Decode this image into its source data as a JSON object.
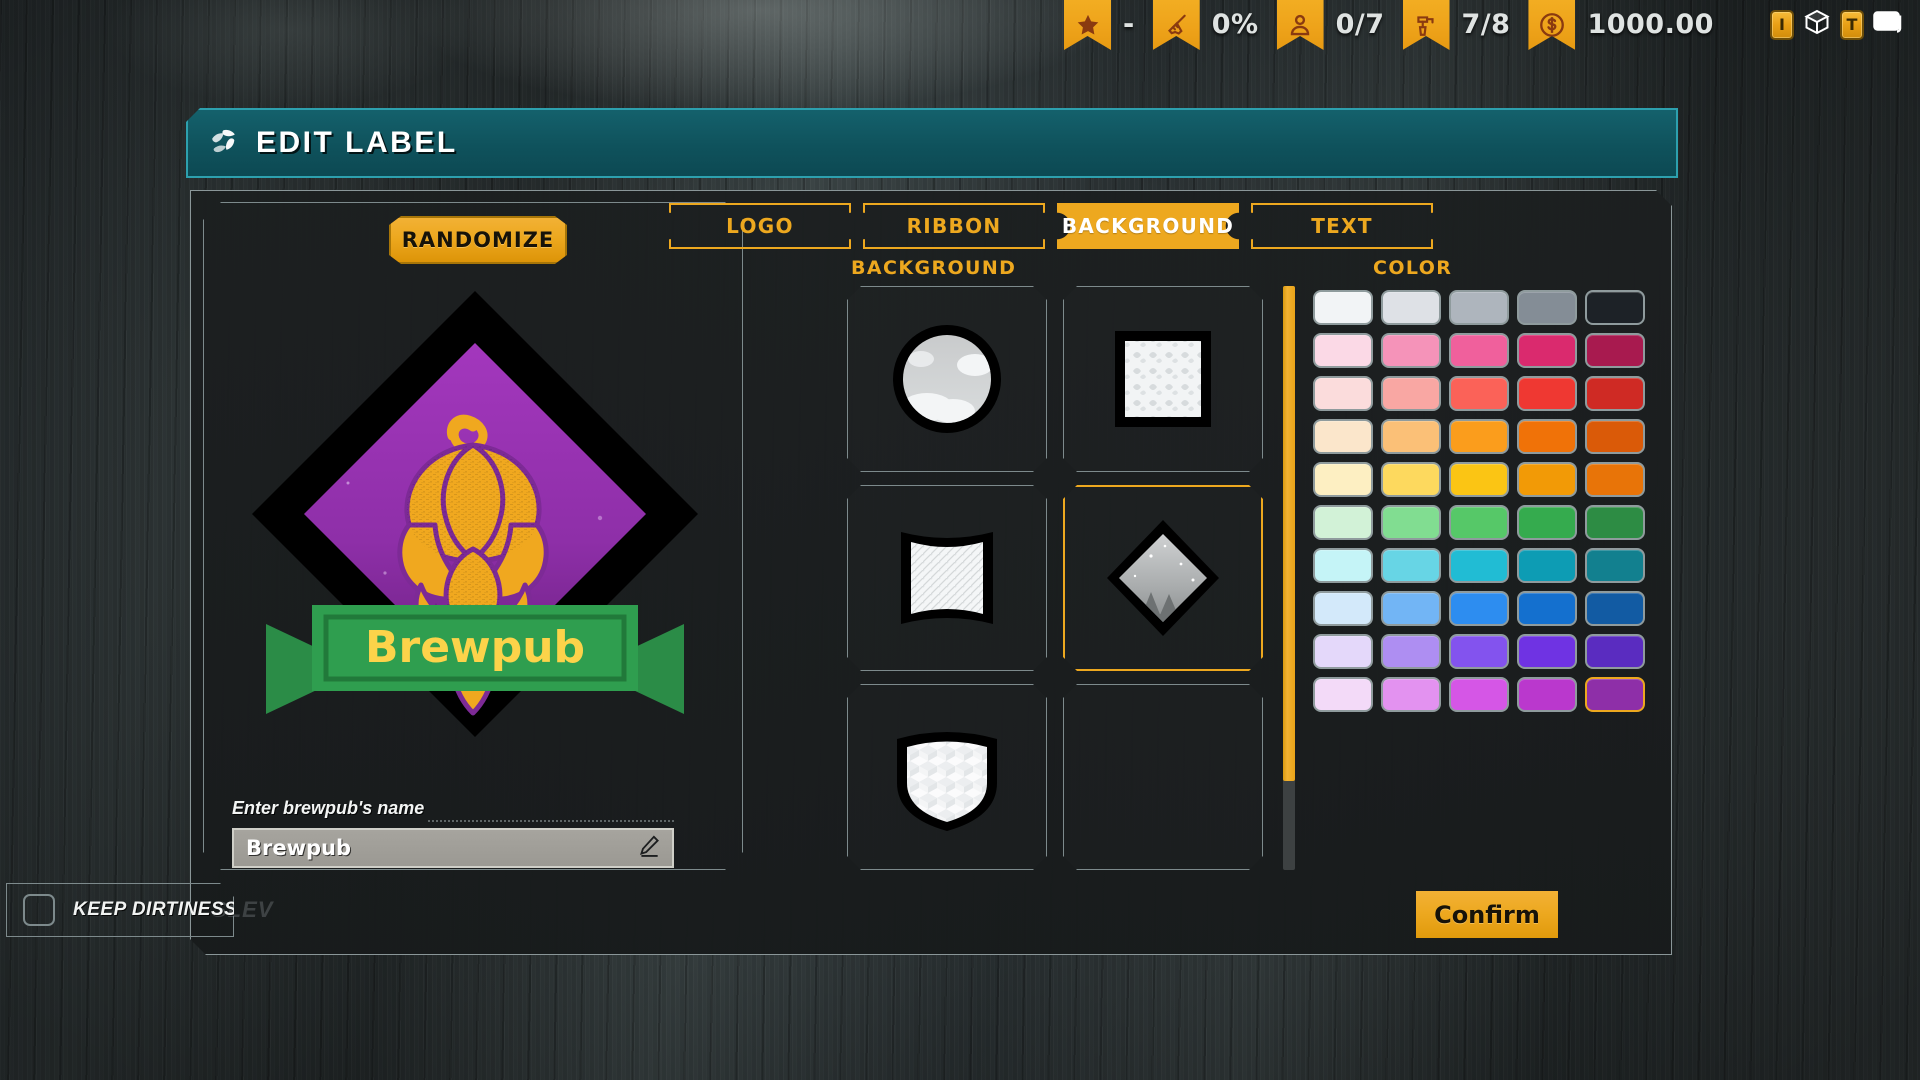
{
  "hud": {
    "stats": [
      {
        "icon": "star-icon",
        "name": "reputation-stat",
        "value": "-"
      },
      {
        "icon": "broom-icon",
        "name": "cleanliness-stat",
        "value": "0%"
      },
      {
        "icon": "person-icon",
        "name": "staff-stat",
        "value": "0/7"
      },
      {
        "icon": "tap-icon",
        "name": "taps-stat",
        "value": "7/8"
      },
      {
        "icon": "coin-icon",
        "name": "money-stat",
        "value": "1000.00"
      }
    ],
    "right_icons": [
      {
        "name": "info-key-badge",
        "label": "I"
      },
      {
        "name": "box-icon",
        "label": ""
      },
      {
        "name": "text-key-badge",
        "label": "T"
      },
      {
        "name": "screen-icon",
        "label": ""
      }
    ]
  },
  "dialog": {
    "title": "EDIT LABEL",
    "title_icon": "hop-cone-icon"
  },
  "preview": {
    "randomize_label": "RANDOMIZE",
    "brand_name": "Brewpub",
    "ribbon_color": "#2f9e4f",
    "ribbon_text_color": "#fcd34a",
    "background_color": "#8e2fa8",
    "logo_color": "#f0a81f",
    "border_color": "#000000"
  },
  "name_field": {
    "label": "Enter brewpub's name",
    "value": "Brewpub",
    "placeholder": "Brewpub",
    "edit_icon": "pencil-icon"
  },
  "tabs": [
    {
      "label": "LOGO",
      "name": "tab-logo",
      "active": false
    },
    {
      "label": "RIBBON",
      "name": "tab-ribbon",
      "active": false
    },
    {
      "label": "BACKGROUND",
      "name": "tab-background",
      "active": true
    },
    {
      "label": "TEXT",
      "name": "tab-text",
      "active": false
    }
  ],
  "captions": {
    "shapes": "BACKGROUND",
    "colors": "COLOR"
  },
  "shapes": [
    {
      "name": "shape-circle-clouds",
      "kind": "circle",
      "selected": false
    },
    {
      "name": "shape-square-floral",
      "kind": "square",
      "selected": false
    },
    {
      "name": "shape-shield-hatch",
      "kind": "shield",
      "selected": false
    },
    {
      "name": "shape-diamond-forest",
      "kind": "diamond",
      "selected": true
    },
    {
      "name": "shape-crest-cubes",
      "kind": "crest",
      "selected": false
    },
    {
      "name": "shape-empty",
      "kind": "empty",
      "selected": false
    }
  ],
  "palette": {
    "selected_index": 49,
    "rows": [
      [
        "#f2f4f6",
        "#dee1e6",
        "#aeb5bd",
        "#848d96",
        "#1d2227"
      ],
      [
        "#fbd9e6",
        "#f593b9",
        "#f0609c",
        "#da2a6e",
        "#a81a4f"
      ],
      [
        "#fbdcdc",
        "#f9a7a3",
        "#fb6258",
        "#ef3832",
        "#cf2a24"
      ],
      [
        "#fbe6cb",
        "#fbc077",
        "#fb9d1c",
        "#f07208",
        "#da5a08"
      ],
      [
        "#fdefc2",
        "#fdd95e",
        "#fbc514",
        "#f29a06",
        "#e87408"
      ],
      [
        "#d2f2d7",
        "#81dd91",
        "#56c868",
        "#35ab4e",
        "#2d8c44"
      ],
      [
        "#c5f4f7",
        "#67d5e5",
        "#21bcd4",
        "#0d9cb4",
        "#12808f"
      ],
      [
        "#d3e9fa",
        "#72b5f5",
        "#2d8df0",
        "#1470cf",
        "#125ba3"
      ],
      [
        "#e4d8fa",
        "#ae8ef2",
        "#8353ee",
        "#6f33e3",
        "#5a2cc0"
      ],
      [
        "#f3daf8",
        "#e392f0",
        "#d556e6",
        "#ba38cd",
        "#8e2fa8"
      ]
    ]
  },
  "confirm": {
    "label": "Confirm"
  },
  "dirtiness": {
    "label": "KEEP DIRTINESS",
    "checked": false,
    "ghost_text": "SLEV"
  }
}
